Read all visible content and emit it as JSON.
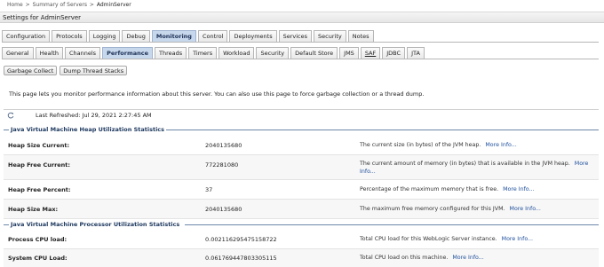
{
  "breadcrumb": {
    "home": "Home",
    "sep": ">",
    "summary": "Summary of Servers",
    "current": "AdminServer"
  },
  "title": "Settings for AdminServer",
  "main_tabs": [
    {
      "label": "Configuration",
      "active": false
    },
    {
      "label": "Protocols",
      "active": false
    },
    {
      "label": "Logging",
      "active": false
    },
    {
      "label": "Debug",
      "active": false
    },
    {
      "label": "Monitoring",
      "active": true
    },
    {
      "label": "Control",
      "active": false
    },
    {
      "label": "Deployments",
      "active": false
    },
    {
      "label": "Services",
      "active": false
    },
    {
      "label": "Security",
      "active": false
    },
    {
      "label": "Notes",
      "active": false
    }
  ],
  "sub_tabs": [
    {
      "label": "General",
      "active": false
    },
    {
      "label": "Health",
      "active": false
    },
    {
      "label": "Channels",
      "active": false
    },
    {
      "label": "Performance",
      "active": true
    },
    {
      "label": "Threads",
      "active": false
    },
    {
      "label": "Timers",
      "active": false
    },
    {
      "label": "Workload",
      "active": false
    },
    {
      "label": "Security",
      "active": false
    },
    {
      "label": "Default Store",
      "active": false
    },
    {
      "label": "JMS",
      "active": false
    },
    {
      "label": "SAF",
      "active": false
    },
    {
      "label": "JDBC",
      "active": false
    },
    {
      "label": "JTA",
      "active": false
    }
  ],
  "buttons": {
    "garbage_collect": "Garbage Collect",
    "dump_threads": "Dump Thread Stacks"
  },
  "intro_text": "This page lets you monitor performance information about this server. You can also use this page to force garbage collection or a thread dump.",
  "last_refreshed": "Last Refreshed: Jul 29, 2021 2:27:45 AM",
  "heap_section": "Java Virtual Machine Heap Utilization Statistics",
  "heap_rows": [
    {
      "label": "Heap Size Current:",
      "value": "2040135680",
      "desc": "The current size (in bytes) of the JVM heap.",
      "more": "More Info..."
    },
    {
      "label": "Heap Free Current:",
      "value": "772281080",
      "desc": "The current amount of memory (in bytes) that is available in the JVM heap.",
      "more": "More Info..."
    },
    {
      "label": "Heap Free Percent:",
      "value": "37",
      "desc": "Percentage of the maximum memory that is free.",
      "more": "More Info..."
    },
    {
      "label": "Heap Size Max:",
      "value": "2040135680",
      "desc": "The maximum free memory configured for this JVM.",
      "more": "More Info..."
    }
  ],
  "cpu_section": "Java Virtual Machine Processor Utilization Statistics",
  "cpu_rows": [
    {
      "label": "Process CPU load:",
      "value": "0.002116295475158722",
      "desc": "Total CPU load for this WebLogic Server instance.",
      "more": "More Info..."
    },
    {
      "label": "System CPU Load:",
      "value": "0.061769447803305115",
      "desc": "Total CPU load on this machine.",
      "more": "More Info..."
    }
  ]
}
